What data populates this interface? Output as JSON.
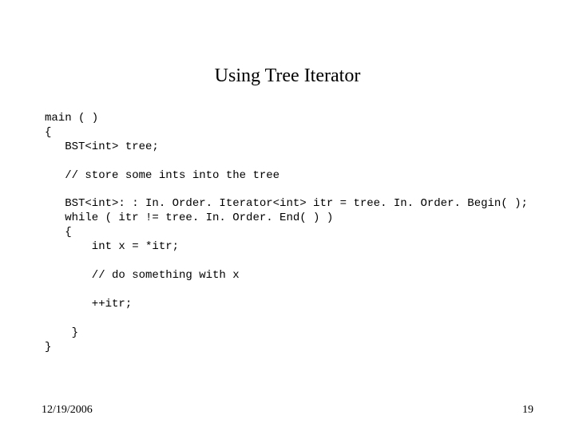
{
  "slide": {
    "title": "Using Tree Iterator",
    "code_lines": [
      "main ( )",
      "{",
      "   BST<int> tree;",
      "",
      "   // store some ints into the tree",
      "",
      "   BST<int>: : In. Order. Iterator<int> itr = tree. In. Order. Begin( );",
      "   while ( itr != tree. In. Order. End( ) )",
      "   {",
      "       int x = *itr;",
      "",
      "       // do something with x",
      "",
      "       ++itr;",
      "",
      "    }",
      "}"
    ],
    "footer": {
      "date": "12/19/2006",
      "page_number": "19"
    }
  }
}
